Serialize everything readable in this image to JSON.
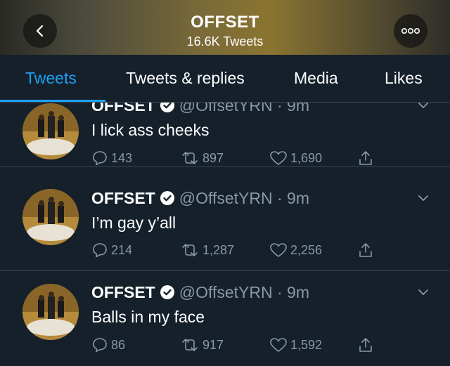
{
  "header": {
    "title": "OFFSET",
    "subtitle": "16.6K Tweets"
  },
  "tabs": [
    {
      "label": "Tweets",
      "active": true
    },
    {
      "label": "Tweets & replies",
      "active": false
    },
    {
      "label": "Media",
      "active": false
    },
    {
      "label": "Likes",
      "active": false
    }
  ],
  "colors": {
    "accent": "#1da1f2",
    "background": "#15202b",
    "muted": "#8899a6"
  },
  "tweets": [
    {
      "name": "OFFSET",
      "handle": "@OffsetYRN",
      "time": "9m",
      "text": "I lick ass cheeks",
      "replies": "143",
      "retweets": "897",
      "likes": "1,690"
    },
    {
      "name": "OFFSET",
      "handle": "@OffsetYRN",
      "time": "9m",
      "text": "I’m gay y’all",
      "replies": "214",
      "retweets": "1,287",
      "likes": "2,256"
    },
    {
      "name": "OFFSET",
      "handle": "@OffsetYRN",
      "time": "9m",
      "text": "Balls in my face",
      "replies": "86",
      "retweets": "917",
      "likes": "1,592"
    }
  ]
}
